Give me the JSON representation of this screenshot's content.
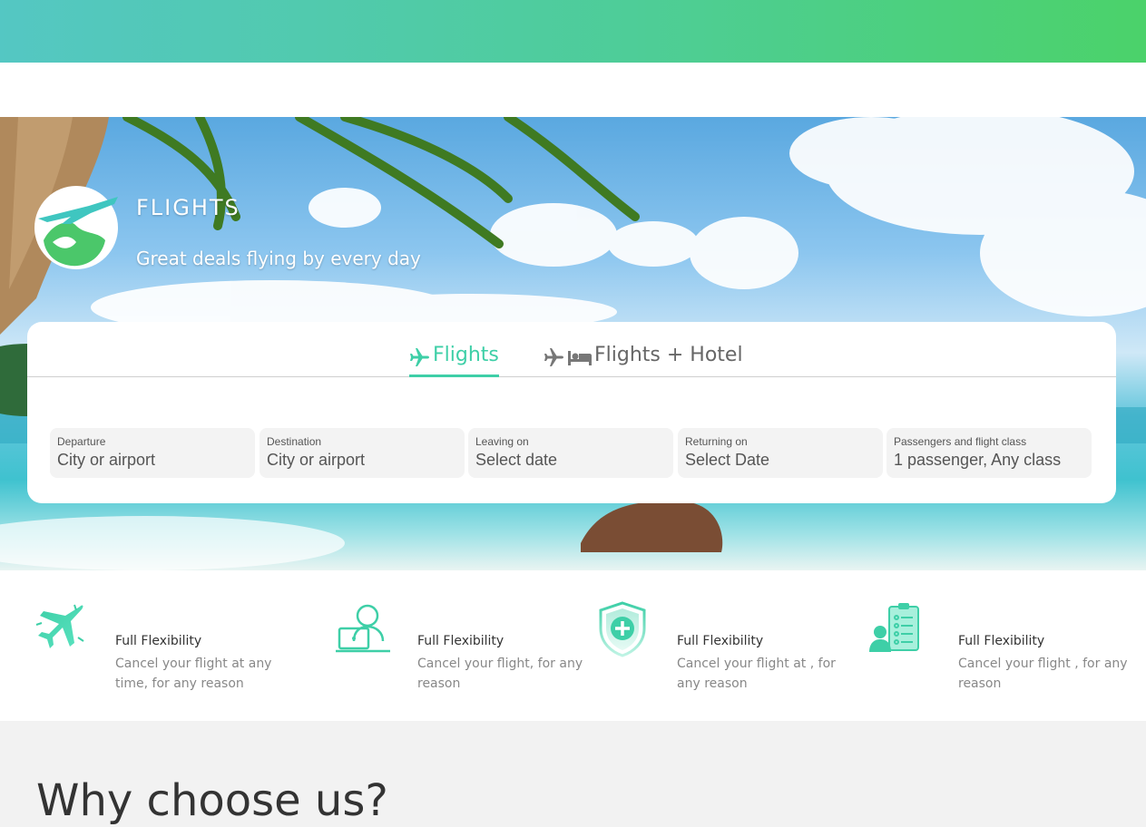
{
  "hero": {
    "title": "FLIGHTS",
    "subtitle": "Great deals flying by every day"
  },
  "tabs": [
    {
      "label": "Flights",
      "icon": "plane-icon",
      "active": true
    },
    {
      "label": "Flights + Hotel",
      "icon": "plane-bed-icon",
      "active": false
    }
  ],
  "search": {
    "fields": [
      {
        "label": "Departure",
        "placeholder": "City or airport"
      },
      {
        "label": "Destination",
        "placeholder": "City or airport"
      },
      {
        "label": "Leaving on",
        "placeholder": "Select date"
      },
      {
        "label": "Returning on",
        "placeholder": "Select Date"
      },
      {
        "label": "Passengers and flight class",
        "placeholder": "1 passenger, Any class"
      }
    ]
  },
  "features": [
    {
      "icon": "airplane-icon",
      "title": "Full Flexibility",
      "desc": "Cancel your flight at any time, for any reason"
    },
    {
      "icon": "person-laptop-icon",
      "title": "Full Flexibility",
      "desc": "Cancel your flight, for any reason"
    },
    {
      "icon": "shield-plus-icon",
      "title": "Full Flexibility",
      "desc": "Cancel your flight at , for any reason"
    },
    {
      "icon": "person-checklist-icon",
      "title": "Full Flexibility",
      "desc": "Cancel your flight , for any reason"
    }
  ],
  "why": {
    "title": "Why choose us?"
  },
  "colors": {
    "accent": "#3ecfa7",
    "header_gradient_start": "#54c7c3",
    "header_gradient_end": "#4bd26a"
  }
}
